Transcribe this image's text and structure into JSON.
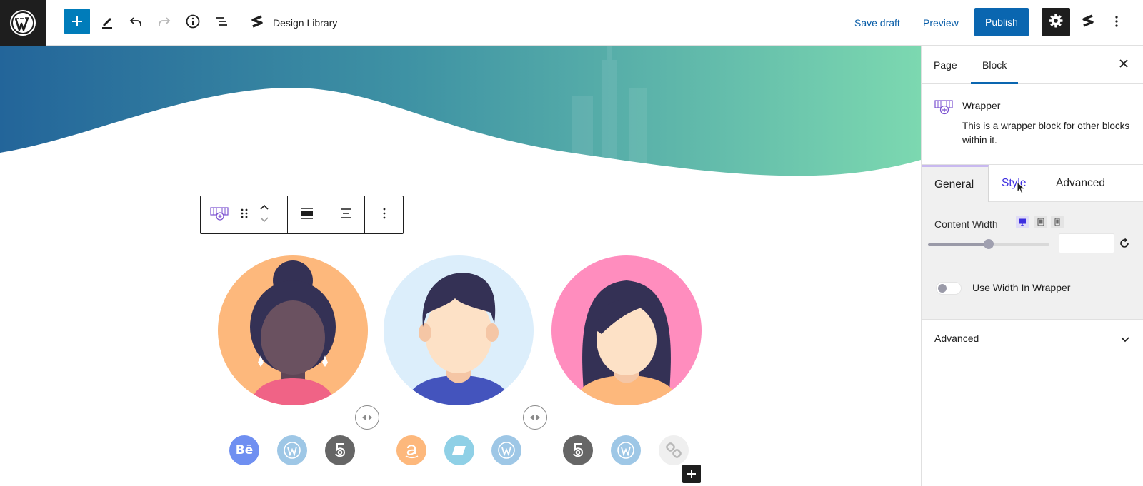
{
  "toolbar": {
    "design_library_label": "Design Library",
    "save_draft_label": "Save draft",
    "preview_label": "Preview",
    "publish_label": "Publish"
  },
  "sidebar": {
    "tabs": [
      {
        "label": "Page",
        "active": false
      },
      {
        "label": "Block",
        "active": true
      }
    ],
    "block": {
      "title": "Wrapper",
      "description": "This is a wrapper block for other blocks within it."
    },
    "inner_tabs": [
      {
        "label": "General",
        "active": true
      },
      {
        "label": "Style",
        "active": false
      },
      {
        "label": "Advanced",
        "active": false
      }
    ],
    "content_width": {
      "label": "Content Width",
      "slider_fraction": 0.5,
      "value": "",
      "devices": [
        "desktop-icon",
        "tablet-icon",
        "mobile-icon"
      ]
    },
    "use_width_toggle": {
      "label": "Use Width In Wrapper",
      "checked": false
    },
    "advanced_section": {
      "title": "Advanced",
      "expanded": false
    }
  },
  "canvas": {
    "team_members": [
      {
        "avatar": "woman-bun-avatar",
        "bg": "#fdb87c",
        "socials": [
          "behance-icon",
          "wordpress-icon",
          "500px-icon"
        ]
      },
      {
        "avatar": "man-avatar",
        "bg": "#dceefb",
        "socials": [
          "amazon-icon",
          "vimeo-icon",
          "wordpress-icon"
        ]
      },
      {
        "avatar": "woman-long-hair-avatar",
        "bg": "#ff8dbe",
        "socials": [
          "500px-icon",
          "wordpress-icon",
          "link-icon"
        ]
      }
    ],
    "social_icons": {
      "behance": "Bē"
    }
  },
  "colors": {
    "accent": "#0a66b0",
    "style_tab": "#3d2ee0",
    "hero_start": "#23659a",
    "hero_end": "#7cd8b0"
  }
}
